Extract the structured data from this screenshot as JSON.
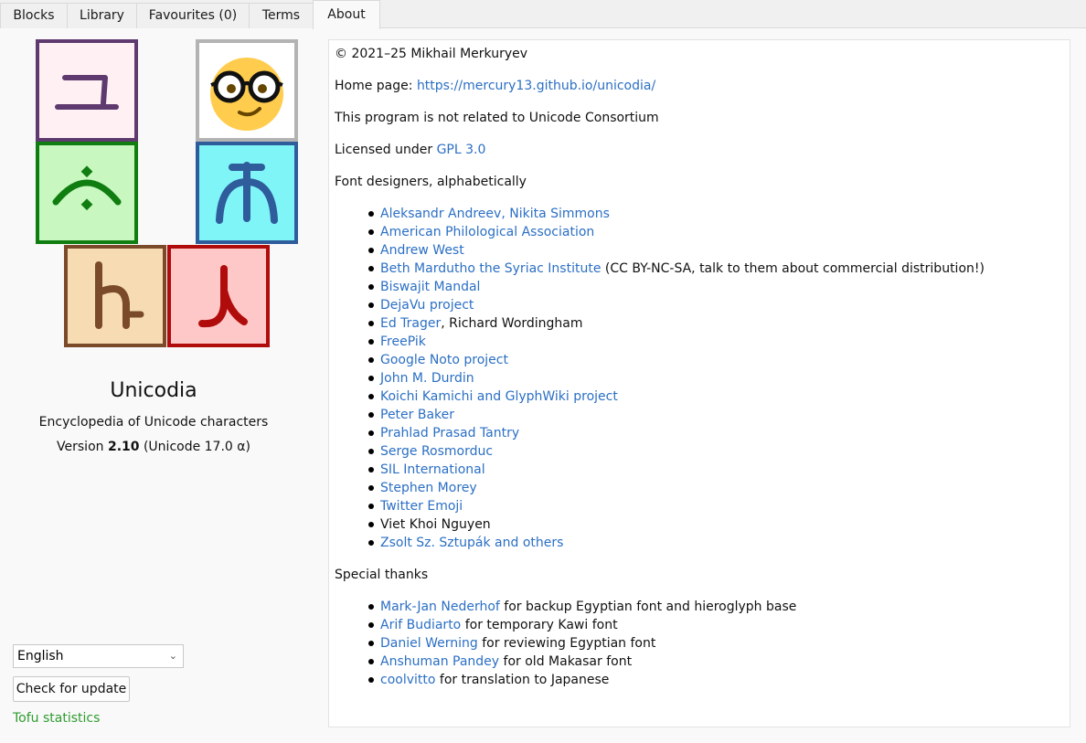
{
  "tabs": [
    {
      "label": "Blocks"
    },
    {
      "label": "Library"
    },
    {
      "label": "Favourites (0)"
    },
    {
      "label": "Terms"
    },
    {
      "label": "About"
    }
  ],
  "active_tab": "About",
  "about": {
    "app_name": "Unicodia",
    "subtitle": "Encyclopedia of Unicode characters",
    "version_prefix": "Version ",
    "version": "2.10",
    "version_suffix": " (Unicode 17.0 α)",
    "language": "English",
    "check_update_label": "Check for update",
    "tofu_link": "Tofu statistics"
  },
  "tiles": [
    {
      "glyph": "ユ",
      "bg": "#fff0f3",
      "border": "#5e3a6e",
      "color": "#5e3a6e"
    },
    {
      "glyph": "emoji-nerd-face",
      "bg": "#ffffff",
      "border": "#b3b3b3"
    },
    {
      "glyph": "ـٔ",
      "bg": "#c9f7c0",
      "border": "#0f7d0f",
      "color": "#0f7d0f"
    },
    {
      "glyph": "ᐂ",
      "bg": "#7ff5f7",
      "border": "#2f5c9b",
      "color": "#2f5c9b"
    },
    {
      "glyph": "ኮ",
      "bg": "#f7dcb3",
      "border": "#7a4a2a",
      "color": "#7a4a2a"
    },
    {
      "glyph": "ꓶ",
      "bg": "#ffc8c8",
      "border": "#b00c0c",
      "color": "#b00c0c"
    }
  ],
  "content": {
    "copyright": "© 2021–25 Mikhail Merkuryev",
    "home_label": "Home page: ",
    "home_url": "https://mercury13.github.io/unicodia/",
    "not_related": "This program is not related to Unicode Consortium",
    "license_label": "Licensed under ",
    "license_link": "GPL 3.0",
    "designers_heading": "Font designers, alphabetically",
    "designers": [
      {
        "link": "Aleksandr Andreev, Nikita Simmons",
        "rest": ""
      },
      {
        "link": "American Philological Association",
        "rest": ""
      },
      {
        "link": "Andrew West",
        "rest": ""
      },
      {
        "link": "Beth Mardutho the Syriac Institute",
        "rest": " (CC BY-NC-SA, talk to them about commercial distribution!)"
      },
      {
        "link": "Biswajit Mandal",
        "rest": ""
      },
      {
        "link": "DejaVu project",
        "rest": ""
      },
      {
        "link": "Ed Trager",
        "rest": ", Richard Wordingham"
      },
      {
        "link": "FreePik",
        "rest": ""
      },
      {
        "link": "Google Noto project",
        "rest": ""
      },
      {
        "link": "John M. Durdin",
        "rest": ""
      },
      {
        "link": "Koichi Kamichi and GlyphWiki project",
        "rest": ""
      },
      {
        "link": "Peter Baker",
        "rest": ""
      },
      {
        "link": "Prahlad Prasad Tantry",
        "rest": ""
      },
      {
        "link": "Serge Rosmorduc",
        "rest": ""
      },
      {
        "link": "SIL International",
        "rest": ""
      },
      {
        "link": "Stephen Morey",
        "rest": ""
      },
      {
        "link": "Twitter Emoji",
        "rest": ""
      },
      {
        "link": "",
        "rest": "Viet Khoi Nguyen"
      },
      {
        "link": "Zsolt Sz. Sztupák and others",
        "rest": ""
      }
    ],
    "thanks_heading": "Special thanks",
    "thanks": [
      {
        "link": "Mark-Jan Nederhof",
        "rest": " for backup Egyptian font and hieroglyph base"
      },
      {
        "link": "Arif Budiarto",
        "rest": " for temporary Kawi font"
      },
      {
        "link": "Daniel Werning",
        "rest": " for reviewing Egyptian font"
      },
      {
        "link": "Anshuman Pandey",
        "rest": " for old Makasar font"
      },
      {
        "link": "coolvitto",
        "rest": " for translation to Japanese"
      }
    ]
  }
}
